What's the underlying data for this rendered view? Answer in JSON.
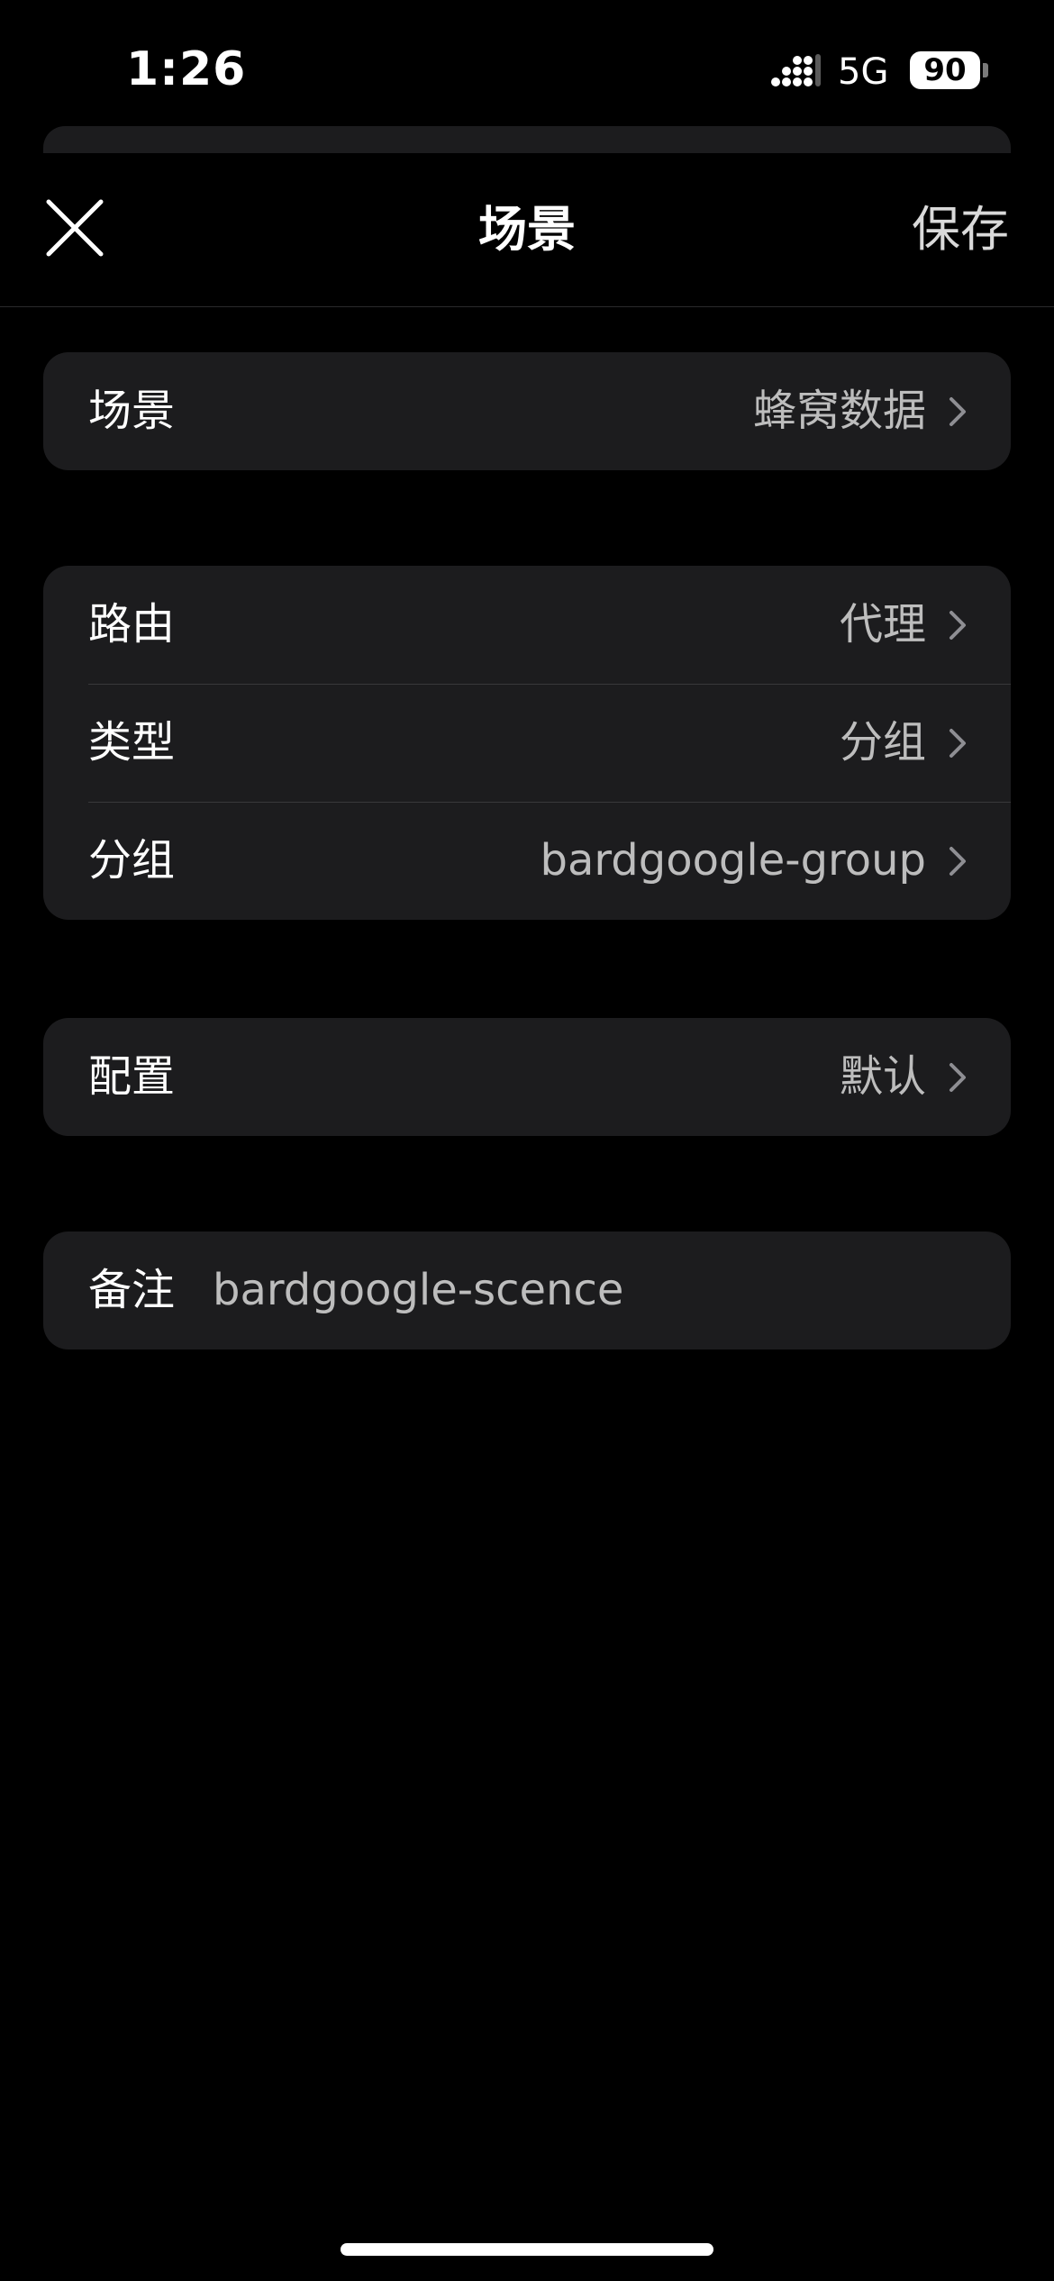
{
  "status_bar": {
    "time": "1:26",
    "network": "5G",
    "battery": "90"
  },
  "header": {
    "title": "场景",
    "save_label": "保存"
  },
  "groups": [
    {
      "rows": [
        {
          "label": "场景",
          "value": "蜂窝数据"
        }
      ]
    },
    {
      "rows": [
        {
          "label": "路由",
          "value": "代理"
        },
        {
          "label": "类型",
          "value": "分组"
        },
        {
          "label": "分组",
          "value": "bardgoogle-group"
        }
      ]
    },
    {
      "rows": [
        {
          "label": "配置",
          "value": "默认"
        }
      ]
    }
  ],
  "note": {
    "label": "备注",
    "value": "bardgoogle-scence"
  },
  "colors": {
    "background": "#000000",
    "cell": "#1c1c1e",
    "separator": "#38383a",
    "secondary_text": "#bdbdbd"
  }
}
